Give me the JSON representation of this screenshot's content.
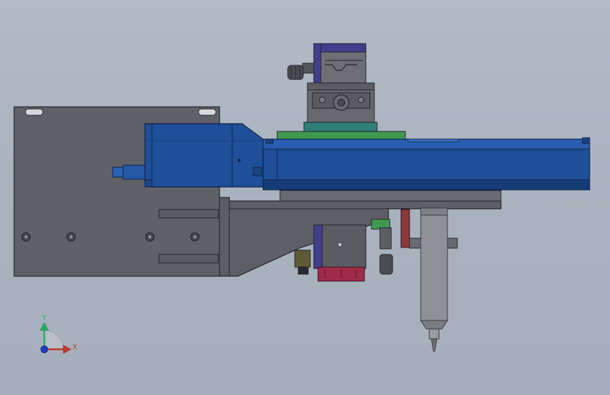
{
  "viewport": {
    "background_top": "#b2bbc6",
    "background_bottom": "#a6b0bc"
  },
  "colors": {
    "plate": "#5f6068",
    "plate_edge": "#24252b",
    "bracket": "#5d5e66",
    "actuator_blue": "#1f4f98",
    "actuator_blue_dark": "#173d78",
    "actuator_edge": "#0e234a",
    "stage_gray": "#6b6b71",
    "stage_top_blue": "#3f3f8e",
    "green_plate": "#3f9a4f",
    "teal_plate": "#2f7f78",
    "crimson_block": "#a02a4a",
    "dispenser_silver": "#8f9095",
    "axis_x": "#c0392b",
    "axis_y": "#27ae60",
    "axis_z": "#1f3fbf"
  },
  "triad": {
    "x_label": "X",
    "y_label": "Y",
    "x_icon": "x-axis-arrow-icon",
    "y_icon": "y-axis-arrow-icon",
    "origin_icon": "z-axis-origin-icon"
  }
}
